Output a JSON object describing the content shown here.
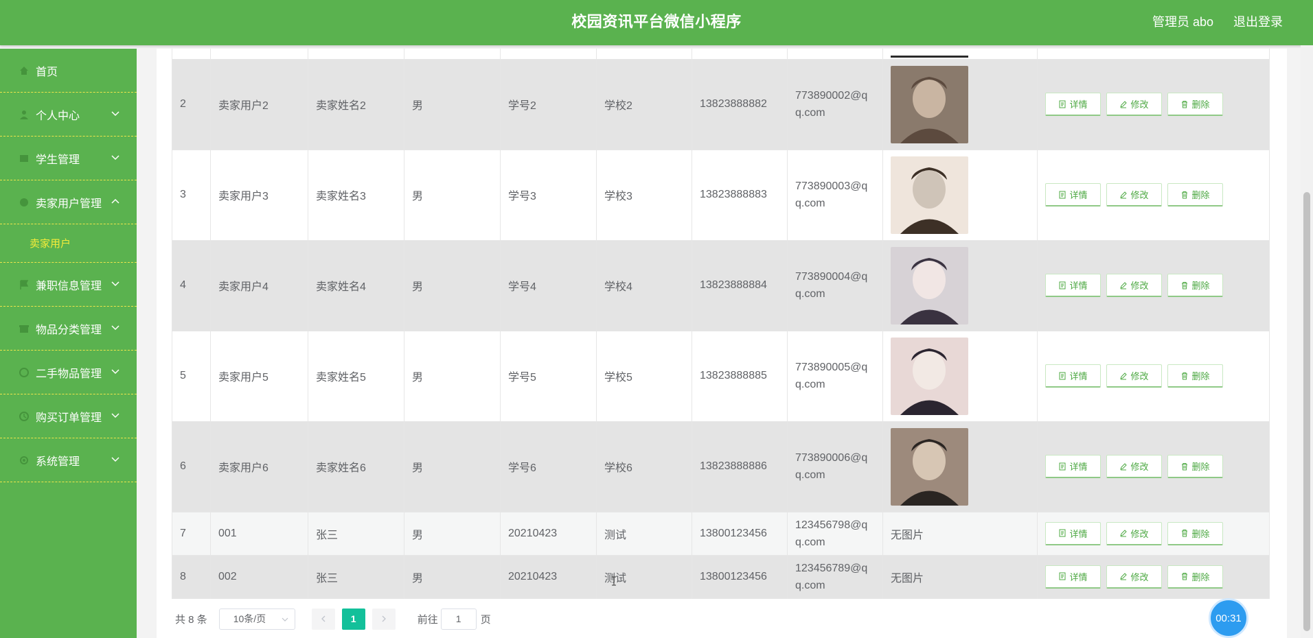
{
  "header": {
    "title": "校园资讯平台微信小程序",
    "admin": "管理员 abo",
    "logout": "退出登录"
  },
  "sidebar": {
    "items": [
      {
        "label": "首页",
        "icon": "home-icon"
      },
      {
        "label": "个人中心",
        "icon": "user-icon"
      },
      {
        "label": "学生管理",
        "icon": "student-icon"
      },
      {
        "label": "卖家用户管理",
        "icon": "seller-icon"
      },
      {
        "label": "兼职信息管理",
        "icon": "flag-icon"
      },
      {
        "label": "物品分类管理",
        "icon": "box-icon"
      },
      {
        "label": "二手物品管理",
        "icon": "goods-icon"
      },
      {
        "label": "购买订单管理",
        "icon": "order-icon"
      },
      {
        "label": "系统管理",
        "icon": "settings-icon"
      }
    ],
    "submenu": {
      "label": "卖家用户"
    }
  },
  "table": {
    "rows": [
      {
        "id": "2",
        "account": "卖家用户2",
        "name": "卖家姓名2",
        "gender": "男",
        "student_no": "学号2",
        "school": "学校2",
        "phone": "13823888882",
        "email": "773890002@qq.com",
        "photo": "photo"
      },
      {
        "id": "3",
        "account": "卖家用户3",
        "name": "卖家姓名3",
        "gender": "男",
        "student_no": "学号3",
        "school": "学校3",
        "phone": "13823888883",
        "email": "773890003@qq.com",
        "photo": "photo"
      },
      {
        "id": "4",
        "account": "卖家用户4",
        "name": "卖家姓名4",
        "gender": "男",
        "student_no": "学号4",
        "school": "学校4",
        "phone": "13823888884",
        "email": "773890004@qq.com",
        "photo": "photo"
      },
      {
        "id": "5",
        "account": "卖家用户5",
        "name": "卖家姓名5",
        "gender": "男",
        "student_no": "学号5",
        "school": "学校5",
        "phone": "13823888885",
        "email": "773890005@qq.com",
        "photo": "photo"
      },
      {
        "id": "6",
        "account": "卖家用户6",
        "name": "卖家姓名6",
        "gender": "男",
        "student_no": "学号6",
        "school": "学校6",
        "phone": "13823888886",
        "email": "773890006@qq.com",
        "photo": "photo"
      },
      {
        "id": "7",
        "account": "001",
        "name": "张三",
        "gender": "男",
        "student_no": "20210423",
        "school": "测试",
        "phone": "13800123456",
        "email": "123456798@qq.com",
        "photo": "无图片"
      },
      {
        "id": "8",
        "account": "002",
        "name": "张三",
        "gender": "男",
        "student_no": "20210423",
        "school": "测试",
        "phone": "13800123456",
        "email": "123456789@qq.com",
        "photo": "无图片"
      }
    ],
    "actions": {
      "detail": "详情",
      "edit": "修改",
      "delete": "删除"
    }
  },
  "pagination": {
    "total": "共 8 条",
    "page_size": "10条/页",
    "current_page": "1",
    "goto_prefix": "前往",
    "goto_value": "1",
    "goto_suffix": "页"
  },
  "timer": "00:31",
  "colors": {
    "primary_green": "#5ab24f",
    "submenu_yellow": "#f5ec3a",
    "pager_active": "#13c09a",
    "timer_blue": "#2d9cf0"
  }
}
